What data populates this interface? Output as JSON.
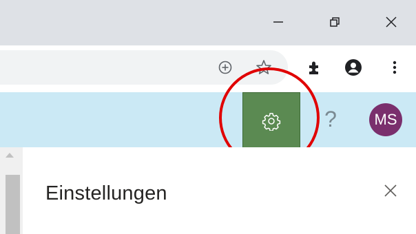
{
  "window_controls": {
    "minimize_icon": "minimize-icon",
    "restore_icon": "restore-icon",
    "close_icon": "close-icon"
  },
  "toolbar": {
    "icons": [
      "zoom-icon",
      "bookmark-star-icon",
      "extensions-icon",
      "profile-icon",
      "more-vert-icon"
    ]
  },
  "header": {
    "help_label": "?",
    "avatar_initials": "MS",
    "settings_icon": "gear-icon"
  },
  "panel": {
    "title": "Einstellungen",
    "close_icon": "close-icon"
  },
  "colors": {
    "titlebar": "#dee1e6",
    "header_band": "#cbe9f5",
    "settings_button": "#5b8a52",
    "avatar": "#7a2f6d",
    "highlight": "#e00000"
  }
}
